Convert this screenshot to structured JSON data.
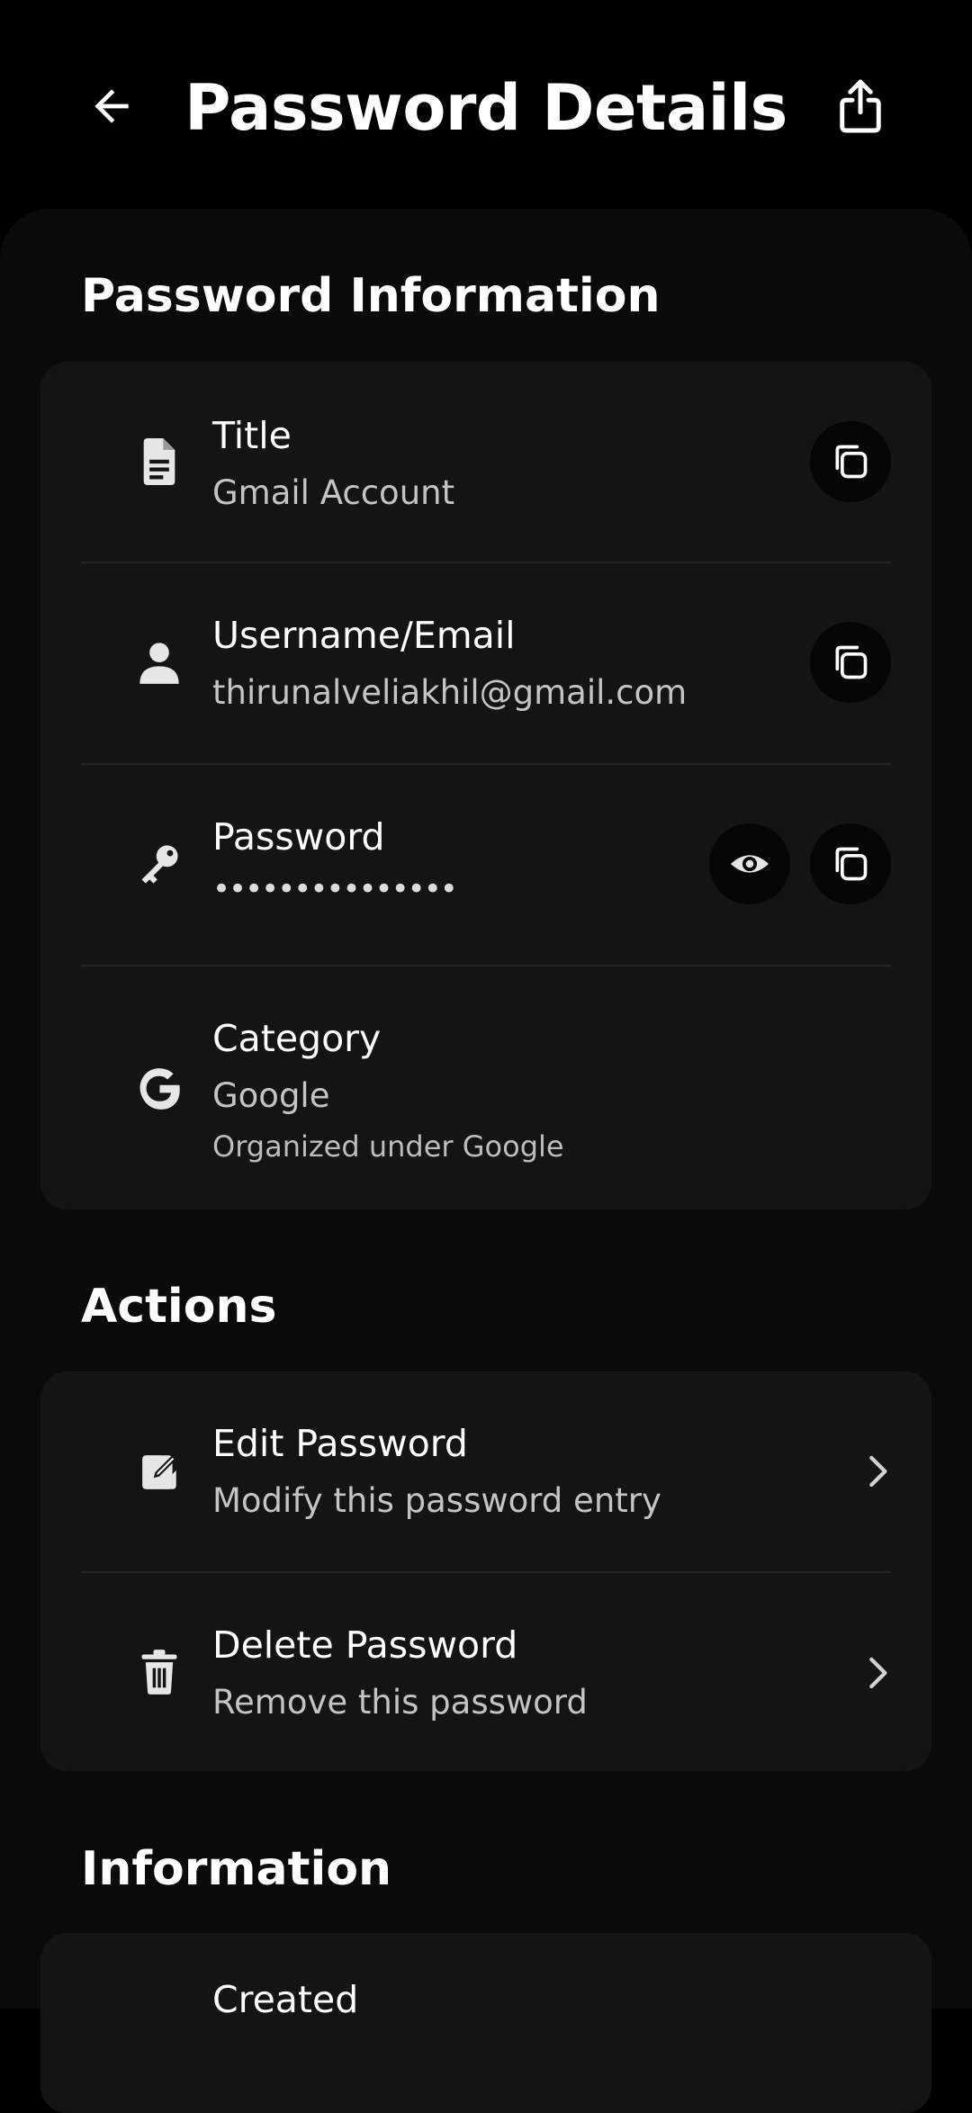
{
  "header": {
    "title": "Password Details"
  },
  "sections": {
    "password_info": {
      "title": "Password Information"
    },
    "actions": {
      "title": "Actions"
    },
    "information": {
      "title": "Information",
      "partial_label": "Created"
    }
  },
  "password_info": {
    "title_row": {
      "label": "Title",
      "value": "Gmail Account"
    },
    "username_row": {
      "label": "Username/Email",
      "value": "thirunalveliakhil@gmail.com"
    },
    "password_row": {
      "label": "Password",
      "value": "•••••••••••••••"
    },
    "category_row": {
      "label": "Category",
      "value": "Google",
      "note": "Organized under Google"
    }
  },
  "actions": {
    "edit": {
      "label": "Edit Password",
      "sub": "Modify this password entry"
    },
    "delete": {
      "label": "Delete Password",
      "sub": "Remove this password"
    }
  },
  "icons": [
    "back-arrow-icon",
    "share-icon",
    "document-icon",
    "person-icon",
    "key-icon",
    "google-icon",
    "copy-icon",
    "eye-icon",
    "edit-icon",
    "trash-icon",
    "chevron-right-icon"
  ],
  "colors": {
    "background": "#000000",
    "sheet": "#0a0a0a",
    "card": "#141414",
    "text_primary": "#ffffff",
    "text_secondary": "#c4c4c4"
  }
}
